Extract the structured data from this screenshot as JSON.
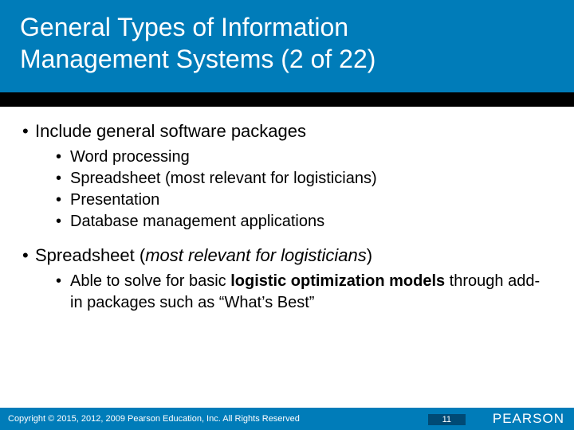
{
  "header": {
    "title_line1": "General Types of Information",
    "title_line2": "Management Systems (2 of 22)"
  },
  "content": {
    "b1": "Include general software packages",
    "b1_items": [
      "Word processing",
      "Spreadsheet (most relevant for logisticians)",
      "Presentation",
      "Database management applications"
    ],
    "b2_prefix": "Spreadsheet (",
    "b2_italic": "most relevant for logisticians",
    "b2_suffix": ")",
    "b2_sub_pre": "Able to solve for basic ",
    "b2_sub_bold": "logistic optimization models",
    "b2_sub_post": " through add-in packages such as “What’s Best”"
  },
  "footer": {
    "copyright": "Copyright © 2015, 2012, 2009 Pearson Education, Inc. All Rights Reserved",
    "page": "11",
    "brand": "PEARSON"
  }
}
